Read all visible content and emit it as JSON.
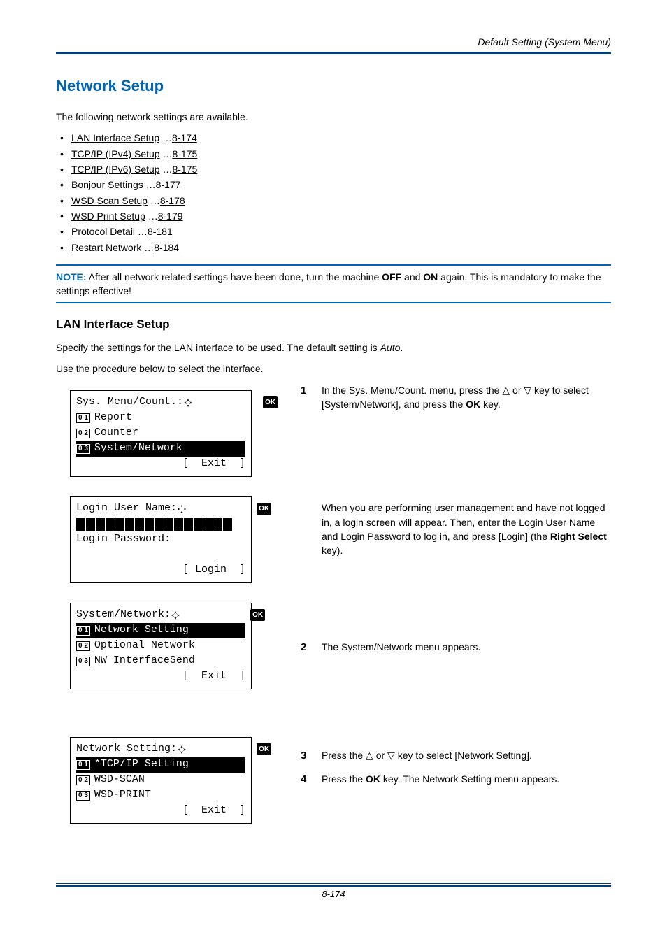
{
  "header": {
    "breadcrumb": "Default Setting (System Menu)"
  },
  "title": "Network Setup",
  "intro": "The following network settings are available.",
  "links": [
    {
      "label": "LAN Interface Setup",
      "page": "8-174"
    },
    {
      "label": "TCP/IP (IPv4) Setup",
      "page": "8-175"
    },
    {
      "label": "TCP/IP (IPv6) Setup",
      "page": "8-175"
    },
    {
      "label": "Bonjour Settings",
      "page": "8-177"
    },
    {
      "label": "WSD Scan Setup",
      "page": "8-178"
    },
    {
      "label": "WSD Print Setup",
      "page": "8-179"
    },
    {
      "label": "Protocol Detail",
      "page": "8-181"
    },
    {
      "label": "Restart Network",
      "page": "8-184"
    }
  ],
  "note": {
    "label": "NOTE:",
    "body_before": " After all network related settings have been done, turn the machine ",
    "off": "OFF",
    "mid": " and ",
    "on": "ON",
    "body_after": " again. This is mandatory to make the settings effective!"
  },
  "subsection": {
    "title": "LAN Interface Setup",
    "p1_before": "Specify the settings for the LAN interface to be used. The default setting is ",
    "p1_italic": "Auto",
    "p1_after": ".",
    "p2": "Use the procedure below to select the interface."
  },
  "lcd1": {
    "title": "Sys. Menu/Count.:",
    "items": [
      {
        "num": "0 1",
        "label": "Report"
      },
      {
        "num": "0 2",
        "label": "Counter"
      },
      {
        "num": "0 3",
        "label": "System/Network"
      }
    ],
    "selected_index": 2,
    "softkey": "[  Exit  ]"
  },
  "lcd2": {
    "title": "Login User Name:",
    "row2": "Login Password:",
    "softkey": "[ Login  ]"
  },
  "lcd3": {
    "title": "System/Network:",
    "items": [
      {
        "num": "0 1",
        "label": "Network Setting"
      },
      {
        "num": "0 2",
        "label": "Optional Network"
      },
      {
        "num": "0 3",
        "label": "NW InterfaceSend"
      }
    ],
    "selected_index": 0,
    "softkey": "[  Exit  ]"
  },
  "lcd4": {
    "title": "Network Setting:",
    "items": [
      {
        "num": "0 1",
        "label": "*TCP/IP Setting"
      },
      {
        "num": "0 2",
        "label": "WSD-SCAN"
      },
      {
        "num": "0 3",
        "label": "WSD-PRINT"
      }
    ],
    "selected_index": 0,
    "softkey": "[  Exit  ]"
  },
  "steps": {
    "s1_num": "1",
    "s1_a": "In the Sys. Menu/Count. menu, press the ",
    "s1_b": " or ",
    "s1_c": " key to select [System/Network], and press the ",
    "s1_ok": "OK",
    "s1_d": " key.",
    "s1_note_a": "When you are performing user management and have not logged in, a login screen will appear. Then, enter the Login User Name and Login Password to log in, and press [Login] (the ",
    "s1_note_bold": "Right Select",
    "s1_note_b": " key).",
    "s2_num": "2",
    "s2": "The System/Network menu appears.",
    "s3_num": "3",
    "s3_a": "Press the ",
    "s3_b": " or ",
    "s3_c": " key to select [Network Setting].",
    "s4_num": "4",
    "s4_a": "Press the ",
    "s4_ok": "OK",
    "s4_b": " key. The Network Setting menu appears."
  },
  "footer": "8-174",
  "glyphs": {
    "up_tri": "△",
    "down_tri": "▽",
    "ok": "OK"
  }
}
